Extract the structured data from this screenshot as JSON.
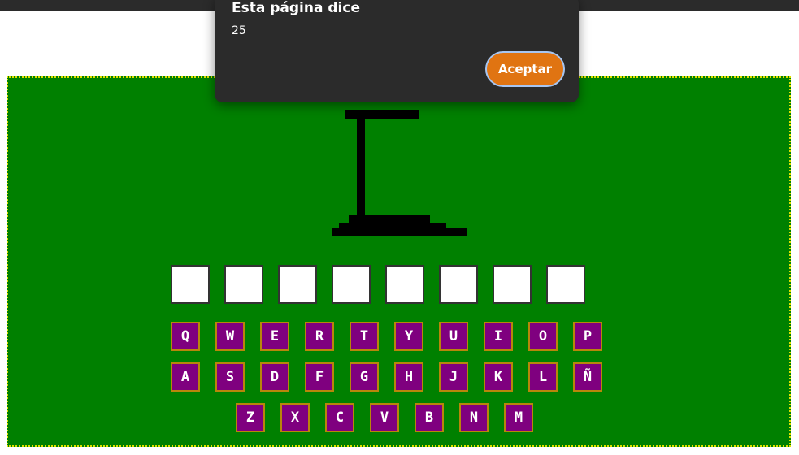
{
  "dialog": {
    "title": "Esta página dice",
    "message": "25",
    "accept_label": "Aceptar"
  },
  "word": {
    "slot_count": 8
  },
  "keyboard": {
    "row1": [
      "Q",
      "W",
      "E",
      "R",
      "T",
      "Y",
      "U",
      "I",
      "O",
      "P"
    ],
    "row2": [
      "A",
      "S",
      "D",
      "F",
      "G",
      "H",
      "J",
      "K",
      "L",
      "Ñ"
    ],
    "row3": [
      "Z",
      "X",
      "C",
      "V",
      "B",
      "N",
      "M"
    ]
  },
  "colors": {
    "board": "#008000",
    "key": "#7f007f",
    "key_border": "#b8860b",
    "dialog_bg": "#2b2b2b",
    "accept_button": "#e07412"
  }
}
